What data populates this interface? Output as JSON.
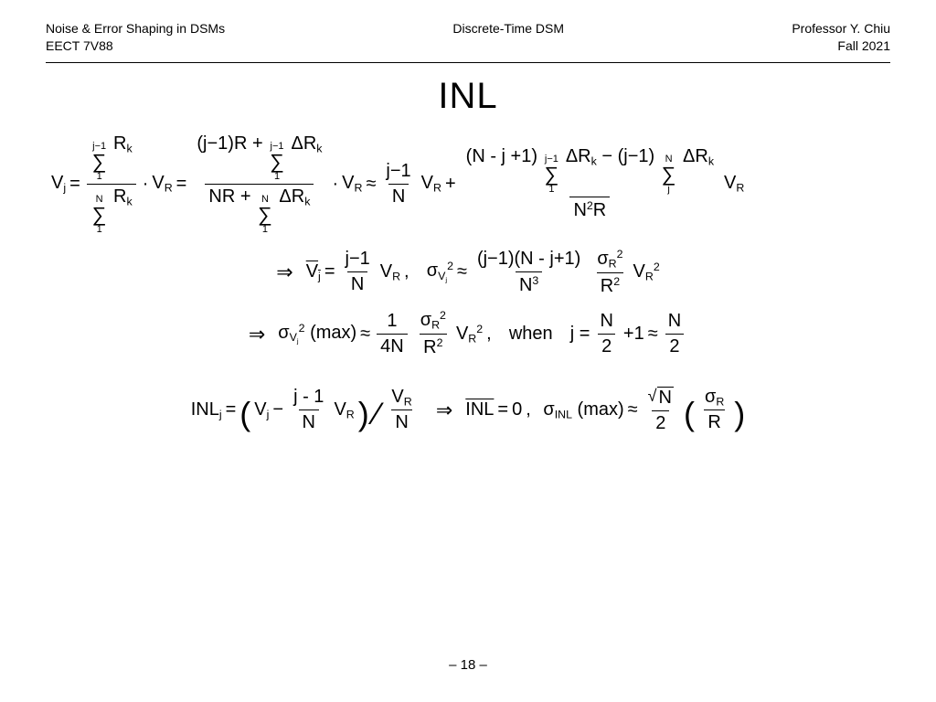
{
  "header": {
    "left_line1": "Noise & Error Shaping in DSMs",
    "left_line2": "EECT 7V88",
    "center_line1": "Discrete-Time DSM",
    "right_line1": "Professor Y. Chiu",
    "right_line2": "Fall 2021"
  },
  "title": "INL",
  "eq1": {
    "Vj": "V",
    "j": "j",
    "sum_top": "j−1",
    "sum_bot": "1",
    "Rk": "R",
    "k": "k",
    "sumN_top": "N",
    "sumN_bot": "1",
    "dot": "·",
    "VR": "V",
    "R": "R",
    "eq": "=",
    "jm1": "(j−1)",
    "Rtxt": "R",
    "plus": "+",
    "DRk": "ΔR",
    "NR": "NR",
    "approx": "≈",
    "frac_jm1_N_num": "j−1",
    "frac_jm1_N_den": "N",
    "Nmj1": "(N - j +1)",
    "minus": "−",
    "jm1b": "(j−1)",
    "sumj_bot": "j",
    "N2R": "N",
    "sq": "2",
    "Rb": "R"
  },
  "eq2": {
    "arrow": "⇒",
    "Vj_bar": "V",
    "j": "j",
    "eq": "=",
    "num": "j−1",
    "den": "N",
    "VR": "V",
    "R": "R",
    "comma": ",",
    "sigma": "σ",
    "Vjsub": "V",
    "sq": "2",
    "approx": "≈",
    "num2": "(j−1)(N - j+1)",
    "den2": "N",
    "cub": "3",
    "sigmaR": "σ",
    "Rs": "R",
    "Rsq": "R"
  },
  "eq3": {
    "arrow": "⇒",
    "sigma": "σ",
    "Vj": "V",
    "j": "j",
    "sq": "2",
    "max": "(max)",
    "approx": "≈",
    "num1": "1",
    "den1": "4N",
    "sigmaR": "σ",
    "R": "R",
    "Rsq": "R",
    "VR": "V",
    "when": "when",
    "jeq": "j",
    "eq": "=",
    "N": "N",
    "two": "2",
    "p1": "+1",
    "appr2": "≈"
  },
  "eq4": {
    "INL": "INL",
    "j": "j",
    "eq": "=",
    "Vj": "V",
    "minus": "−",
    "num": "j - 1",
    "den": "N",
    "VR": "V",
    "R": "R",
    "over": "V",
    "Rn": "R",
    "Nn": "N",
    "arrow": "⇒",
    "INLbar": "INL",
    "zero": "0",
    "comma": ",",
    "sigma": "σ",
    "INLs": "INL",
    "max": "(max)",
    "approx": "≈",
    "sqrtN": "N",
    "two": "2",
    "sigmaR": "σ",
    "Rs": "R",
    "Rb": "R"
  },
  "footer": "– 18 –"
}
